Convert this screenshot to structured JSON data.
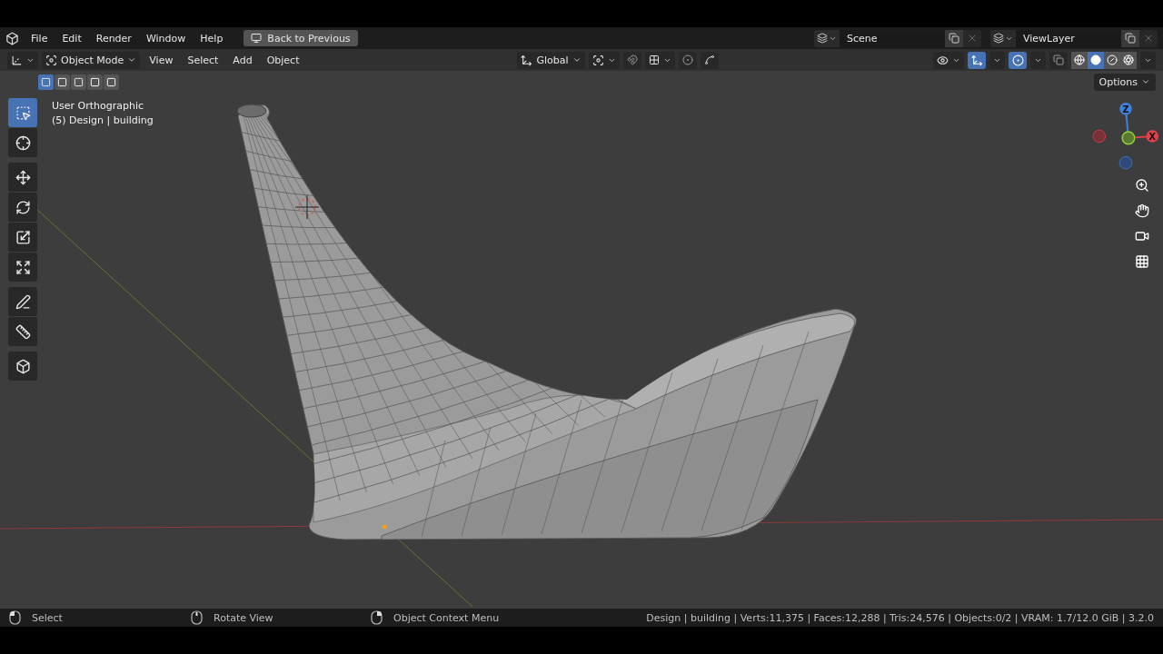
{
  "menu_bar": {
    "items": [
      "File",
      "Edit",
      "Render",
      "Window",
      "Help"
    ],
    "back_button": "Back to Previous",
    "scene": "Scene",
    "view_layer": "ViewLayer"
  },
  "header": {
    "mode": "Object Mode",
    "menus": [
      "View",
      "Select",
      "Add",
      "Object"
    ],
    "orientation": "Global",
    "snap_on": false,
    "proportional_on": false,
    "gizmo_on": true,
    "overlays_on": true,
    "xray_on": false,
    "shading": [
      {
        "kind": "wireframe",
        "selected": false
      },
      {
        "kind": "solid",
        "selected": true
      },
      {
        "kind": "material",
        "selected": false
      },
      {
        "kind": "rendered",
        "selected": false
      }
    ]
  },
  "select_modes": [
    {
      "kind": "new",
      "selected": true
    },
    {
      "kind": "extend",
      "selected": false
    },
    {
      "kind": "subtract",
      "selected": false
    },
    {
      "kind": "invert",
      "selected": false
    },
    {
      "kind": "intersect",
      "selected": false
    }
  ],
  "options_button": "Options",
  "toolbar": [
    {
      "kind": "select",
      "selected": true
    },
    {
      "kind": "cursor",
      "selected": false
    },
    {
      "kind": "move",
      "selected": false
    },
    {
      "kind": "rotate",
      "selected": false
    },
    {
      "kind": "scale",
      "selected": false
    },
    {
      "kind": "transform",
      "selected": false
    },
    {
      "kind": "annotate",
      "selected": false
    },
    {
      "kind": "measure",
      "selected": false
    },
    {
      "kind": "add_cube",
      "selected": false
    }
  ],
  "viewport": {
    "view_name": "User Orthographic",
    "object_info": "(5) Design | building",
    "gizmo": {
      "z_label": "Z",
      "x_label": "X"
    }
  },
  "status_bar": {
    "hints": [
      {
        "kind": "left",
        "label": "Select"
      },
      {
        "kind": "middle",
        "label": "Rotate View"
      },
      {
        "kind": "right",
        "label": "Object Context Menu"
      }
    ],
    "stats": "Design | building | Verts:11,375 | Faces:12,288 | Tris:24,576 | Objects:0/2 | VRAM: 1.7/12.0 GiB | 3.2.0"
  }
}
